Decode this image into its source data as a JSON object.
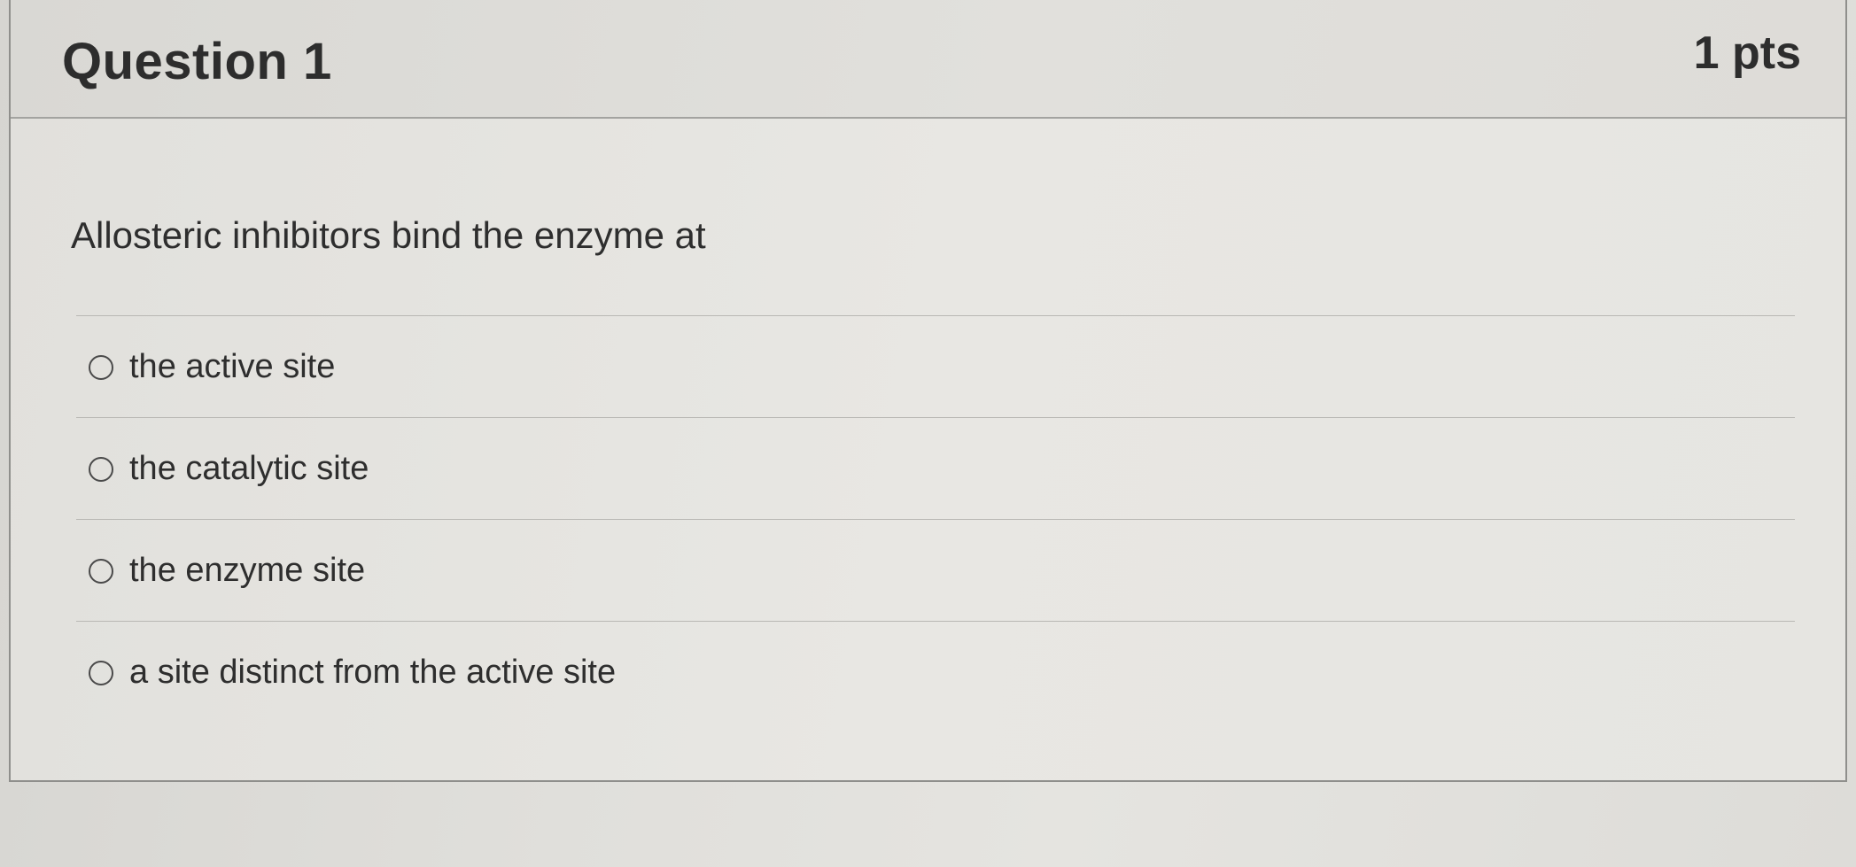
{
  "question": {
    "title": "Question 1",
    "points": "1 pts",
    "text": "Allosteric inhibitors bind the enzyme at"
  },
  "answers": [
    {
      "label": "the active site",
      "selected": false
    },
    {
      "label": "the catalytic site",
      "selected": false
    },
    {
      "label": "the enzyme site",
      "selected": false
    },
    {
      "label": "a site distinct from the active site",
      "selected": false
    }
  ]
}
